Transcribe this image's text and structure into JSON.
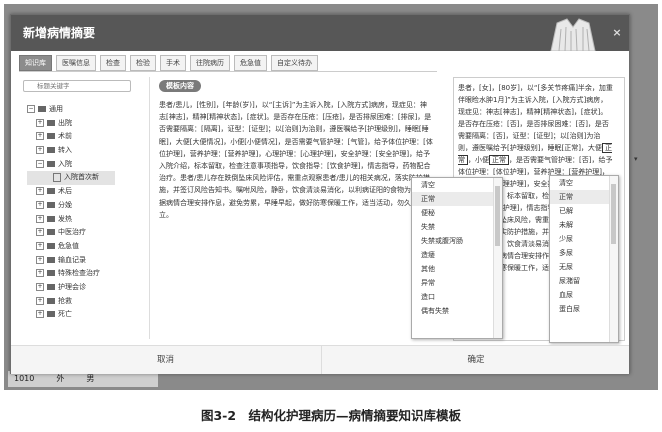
{
  "dialog": {
    "title": "新增病情摘要",
    "close": "×"
  },
  "tabs": [
    {
      "label": "知识库",
      "active": true
    },
    {
      "label": "医嘱信息",
      "active": false
    },
    {
      "label": "检查",
      "active": false
    },
    {
      "label": "检验",
      "active": false
    },
    {
      "label": "手术",
      "active": false
    },
    {
      "label": "往院病历",
      "active": false
    },
    {
      "label": "危急值",
      "active": false
    },
    {
      "label": "自定义待办",
      "active": false
    }
  ],
  "search": {
    "placeholder": "标题关键字"
  },
  "tree": {
    "root": "通用",
    "items": [
      "出院",
      "术前",
      "转入",
      "入院"
    ],
    "selected": "入院首次新",
    "items_after": [
      "术后",
      "分娩",
      "发热",
      "中医治疗",
      "危急值",
      "输血记录",
      "特殊检查治疗",
      "护理会诊",
      "抢救",
      "死亡"
    ]
  },
  "template": {
    "header": "模板内容",
    "text": "患者/患儿，[性别]，[年龄(岁)]，以“[主诉]”为主诉入院，[入院方式]病房，现症见：神志[神志]，精神[精神状态]，[症状]。是否存在压疮：[压疮]，是否排尿困难：[排尿]，是否需要隔离：[隔离]，证型：[证型]；以[治则]为治则，遵医嘱给予[护理级别]，睡眠[睡眠]，大便[大便情况]，小便[小便情况]，是否需要气管护理：[气管]，给予体位护理：[体位护理]，营养护理：[营养护理]，心理护理：[心理护理]，安全护理：[安全护理]，给予入院介绍，标本留取，检查注意事项指导，饮食指导：[饮食护理]，情志指导，药物配合治疗。患者/患儿存在跌倒坠床风险评估，需重点观察患者/患儿的相关病况，落实防护措施，并签订风险告知书。嘱咐风险，静卧，饮食清淡易消化，以利病证阳的食物为主，根据病情合理安排作息，避免劳累，早睡早起，做好防寒保暖工作，适当活动，勿久坐，久立。"
  },
  "preview": {
    "text_before": "患者，[女]，[80岁]，以“[多关节疼痛]半余，加重伴眼睑水肿1月]”为主诉入院，[入院方式]病房，现症见：神志[神志]，精神[精神状态]，[症状]。是否存在压疮：[否]，是否排尿困难：[否]，是否需要隔离：[否]，证型：[证型]；以[治则]为治则，遵医嘱给予[护理级别]，睡眠[正常]，大便",
    "box1": "正常",
    "text_mid": "，小便",
    "box2": "正常",
    "text_after": "，是否需要气管护理：[否]，给予体位护理：[体位护理]，营养护理：[营养护理]，心理护理：[心理护理]，安全护理：[安全护理]，给予入院介绍，标本留取，检查注意事项指导，饮食指导：[饮食护理]，情志指导，药物配合治疗。患者存在跌倒坠床风险，需重点观察患者/患儿的相关病况，落实防护措施，并签订风险告知书。嘱咐风险，静卧，饮食清淡易消化，以利病证阳的食物为主，根据病情合理安排作息，避免劳累，早睡早起，做好防寒保暖工作，适当活动，勿久坐，久立。"
  },
  "dropdown_stool": {
    "items": [
      "清空",
      "正常",
      "便秘",
      "失禁",
      "失禁或腹泻肠",
      "造瘘",
      "其他",
      "异常",
      "造口",
      "偶有失禁"
    ],
    "highlighted": "正常"
  },
  "dropdown_urine": {
    "items": [
      "清空",
      "正常",
      "已解",
      "未解",
      "少尿",
      "多尿",
      "无尿",
      "尿潴留",
      "血尿",
      "蛋白尿"
    ],
    "highlighted": "正常"
  },
  "footer": {
    "cancel": "取消",
    "ok": "确定"
  },
  "background": {
    "cells": [
      "1010",
      "外",
      "男"
    ]
  },
  "caption": "图3-2　结构化护理病历—病情摘要知识库模板"
}
